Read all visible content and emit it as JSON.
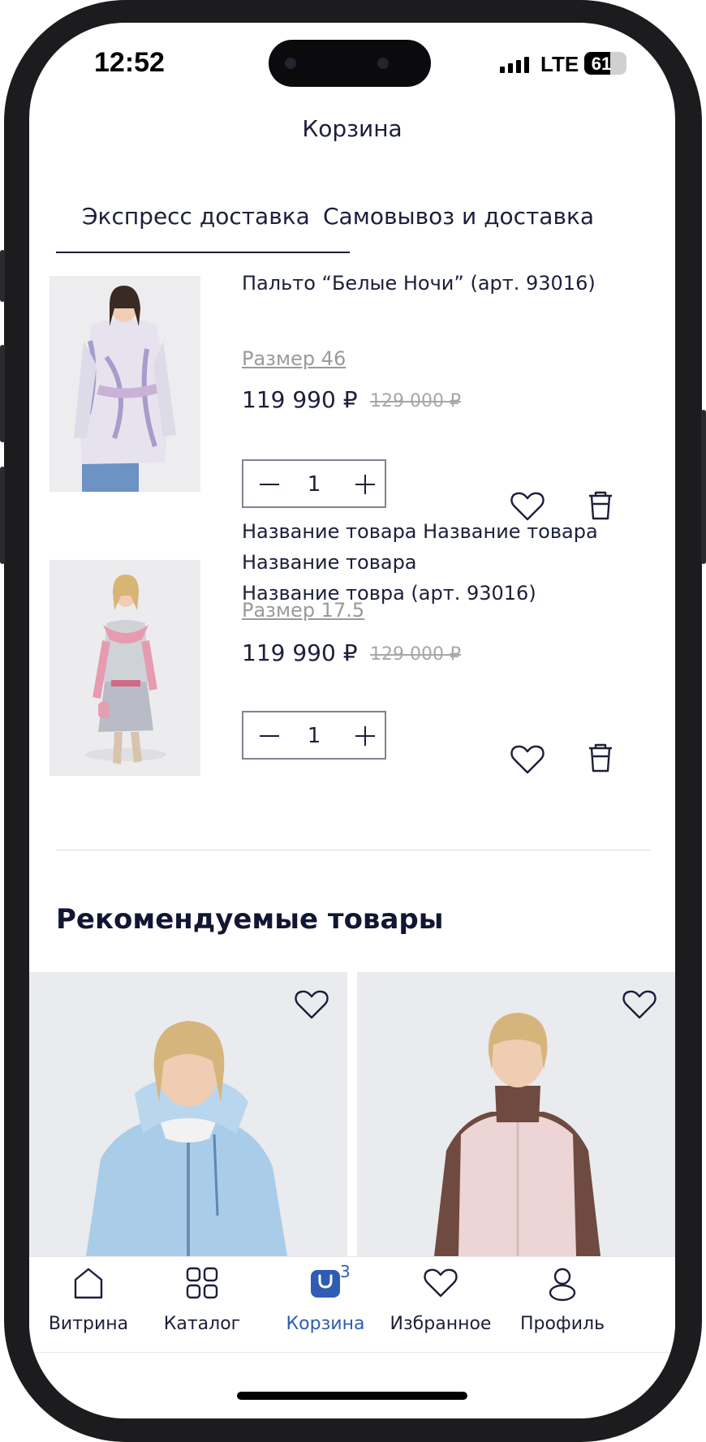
{
  "status_bar": {
    "time": "12:52",
    "network": "LTE",
    "battery_level": "61"
  },
  "header": {
    "title": "Корзина"
  },
  "tabs": [
    {
      "label": "Экспресс доставка",
      "active": true
    },
    {
      "label": "Самовывоз и доставка",
      "active": false
    }
  ],
  "cart_items": [
    {
      "title_lines": [
        "Пальто “Белые Ночи” (арт. 93016)"
      ],
      "size": "Размер 46",
      "price": "119 990 ₽",
      "old_price": "129 000 ₽",
      "quantity": "1"
    },
    {
      "title_lines": [
        "Название товара Название товара",
        "Название товара",
        "Название товра (арт. 93016)"
      ],
      "size": "Размер 17.5",
      "price": "119 990 ₽",
      "old_price": "129 000 ₽",
      "quantity": "1"
    }
  ],
  "recommended": {
    "title": "Рекомендуемые товары"
  },
  "bottom_nav": [
    {
      "label": "Витрина",
      "icon": "home-icon"
    },
    {
      "label": "Каталог",
      "icon": "grid-icon"
    },
    {
      "label": "Корзина",
      "icon": "bag-icon",
      "badge": "3",
      "active": true
    },
    {
      "label": "Избранное",
      "icon": "heart-icon"
    },
    {
      "label": "Профиль",
      "icon": "profile-icon"
    }
  ],
  "colors": {
    "text": "#1b1f3a",
    "accent": "#2f5db3",
    "muted": "#9a9a9a"
  }
}
